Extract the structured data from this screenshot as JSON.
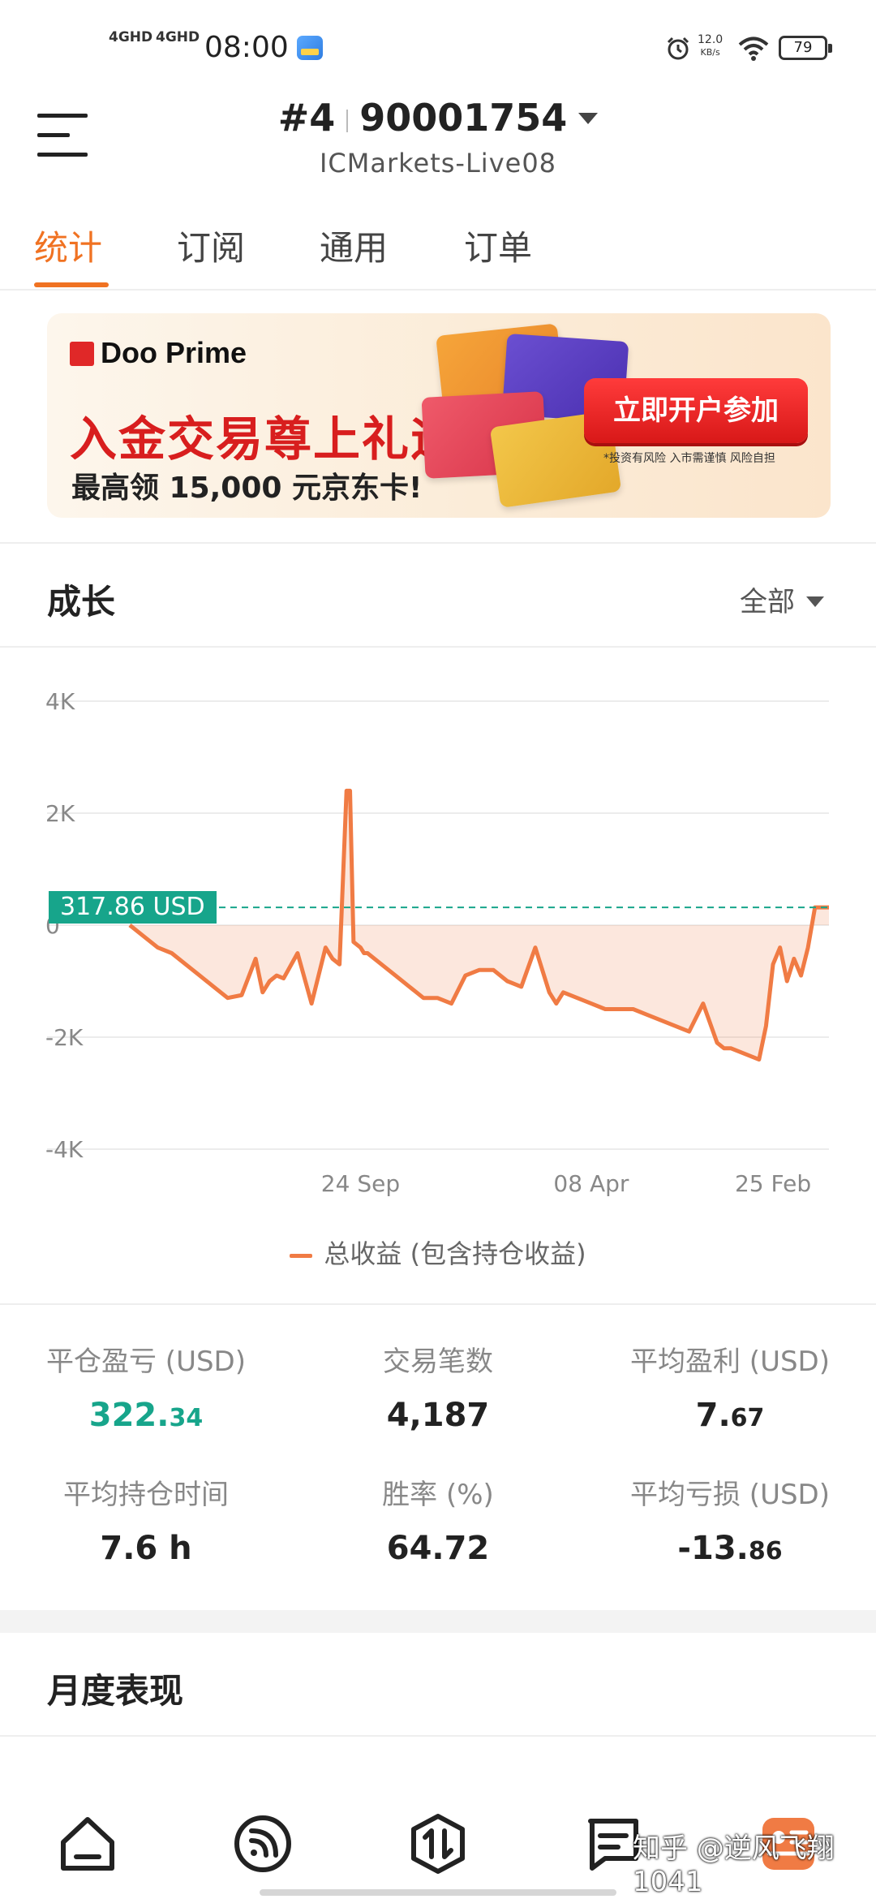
{
  "status_bar": {
    "signal_1": "4GHD",
    "signal_2": "4GHD",
    "time": "08:00",
    "net_speed_value": "12.0",
    "net_speed_unit": "KB/s",
    "battery": "79"
  },
  "header": {
    "account_prefix": "#4",
    "account_number": "90001754",
    "server": "ICMarkets-Live08"
  },
  "tabs": [
    {
      "label": "统计",
      "active": true
    },
    {
      "label": "订阅",
      "active": false
    },
    {
      "label": "通用",
      "active": false
    },
    {
      "label": "订单",
      "active": false
    }
  ],
  "banner": {
    "brand": "Doo Prime",
    "headline": "入金交易尊上礼遇",
    "subline": "最高领 15,000 元京东卡!",
    "cta": "立即开户参加",
    "disclaimer": "*投资有风险 入市需谨慎 风险自担"
  },
  "growth": {
    "title": "成长",
    "filter": "全部",
    "current_value_tag": "317.86 USD",
    "legend": "总收益 (包含持仓收益)"
  },
  "chart_data": {
    "type": "area",
    "y_ticks": [
      "4K",
      "2K",
      "0",
      "-2K",
      "-4K"
    ],
    "ylim": [
      -4000,
      4000
    ],
    "x_ticks": [
      "24 Sep",
      "08 Apr",
      "25 Feb"
    ],
    "x_tick_positions": [
      0.33,
      0.66,
      0.92
    ],
    "series": [
      {
        "name": "总收益 (包含持仓收益)",
        "color": "#f07b44",
        "x": [
          0.0,
          0.02,
          0.04,
          0.06,
          0.08,
          0.1,
          0.12,
          0.14,
          0.16,
          0.18,
          0.19,
          0.2,
          0.21,
          0.22,
          0.24,
          0.26,
          0.27,
          0.28,
          0.29,
          0.3,
          0.31,
          0.315,
          0.32,
          0.33,
          0.335,
          0.34,
          0.36,
          0.38,
          0.4,
          0.42,
          0.44,
          0.46,
          0.48,
          0.5,
          0.52,
          0.54,
          0.56,
          0.58,
          0.6,
          0.61,
          0.62,
          0.64,
          0.66,
          0.68,
          0.7,
          0.72,
          0.74,
          0.76,
          0.78,
          0.8,
          0.82,
          0.84,
          0.85,
          0.86,
          0.88,
          0.9,
          0.91,
          0.92,
          0.93,
          0.94,
          0.95,
          0.96,
          0.97,
          0.98,
          0.99,
          1.0
        ],
        "values": [
          0,
          -200,
          -400,
          -500,
          -700,
          -900,
          -1100,
          -1300,
          -1250,
          -600,
          -1200,
          -1000,
          -900,
          -950,
          -500,
          -1400,
          -900,
          -400,
          -600,
          -700,
          2400,
          2400,
          -300,
          -400,
          -500,
          -500,
          -700,
          -900,
          -1100,
          -1300,
          -1300,
          -1400,
          -900,
          -800,
          -800,
          -1000,
          -1100,
          -400,
          -1200,
          -1400,
          -1200,
          -1300,
          -1400,
          -1500,
          -1500,
          -1500,
          -1600,
          -1700,
          -1800,
          -1900,
          -1400,
          -2100,
          -2200,
          -2200,
          -2300,
          -2400,
          -1800,
          -700,
          -400,
          -1000,
          -600,
          -900,
          -400,
          317.86,
          317.86,
          317.86
        ]
      }
    ],
    "reference_line": 317.86
  },
  "stats": [
    {
      "label": "平仓盈亏 (USD)",
      "int": "322.",
      "dec": "34",
      "highlight": true
    },
    {
      "label": "交易笔数",
      "int": "4,187",
      "dec": "",
      "highlight": false
    },
    {
      "label": "平均盈利 (USD)",
      "int": "7.",
      "dec": "67",
      "highlight": false
    },
    {
      "label": "平均持仓时间",
      "int": "7.6 h",
      "dec": "",
      "highlight": false
    },
    {
      "label": "胜率 (%)",
      "int": "64.72",
      "dec": "",
      "highlight": false
    },
    {
      "label": "平均亏损 (USD)",
      "int": "-13.",
      "dec": "86",
      "highlight": false
    }
  ],
  "monthly": {
    "title": "月度表现"
  },
  "bottom_nav": [
    {
      "icon": "home-icon"
    },
    {
      "icon": "signal-icon"
    },
    {
      "icon": "trade-icon"
    },
    {
      "icon": "list-icon"
    },
    {
      "icon": "gift-icon"
    }
  ],
  "watermark": "知乎 @逆风飞翔1041"
}
